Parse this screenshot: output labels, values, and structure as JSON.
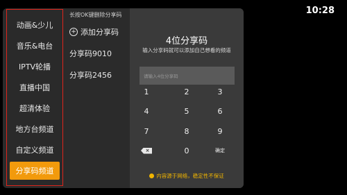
{
  "status_bar": {
    "time": "10:28"
  },
  "sidebar": {
    "items": [
      {
        "label": "动画&少儿",
        "active": false
      },
      {
        "label": "音乐&电台",
        "active": false
      },
      {
        "label": "IPTV轮播",
        "active": false
      },
      {
        "label": "直播中国",
        "active": false
      },
      {
        "label": "超清体验",
        "active": false
      },
      {
        "label": "地方台频道",
        "active": false
      },
      {
        "label": "自定义频道",
        "active": false
      },
      {
        "label": "分享码频道",
        "active": true
      }
    ]
  },
  "share_list": {
    "hint": "长按OK键删除分享码",
    "add_label": "添加分享码",
    "items": [
      "分享码9010",
      "分享码2456"
    ]
  },
  "code_entry": {
    "title": "4位分享码",
    "subtitle": "输入分享码就可以添加自己想看的频道",
    "placeholder": "请输入4位分享码",
    "keys": [
      "1",
      "2",
      "3",
      "4",
      "5",
      "6",
      "7",
      "8",
      "9",
      "0"
    ],
    "confirm_label": "确定",
    "backspace_label": "×",
    "notice": "内容源于网络，稳定性不保证"
  },
  "colors": {
    "accent": "#f29a0c",
    "border_highlight": "#e0241b",
    "notice": "#f0b400"
  }
}
